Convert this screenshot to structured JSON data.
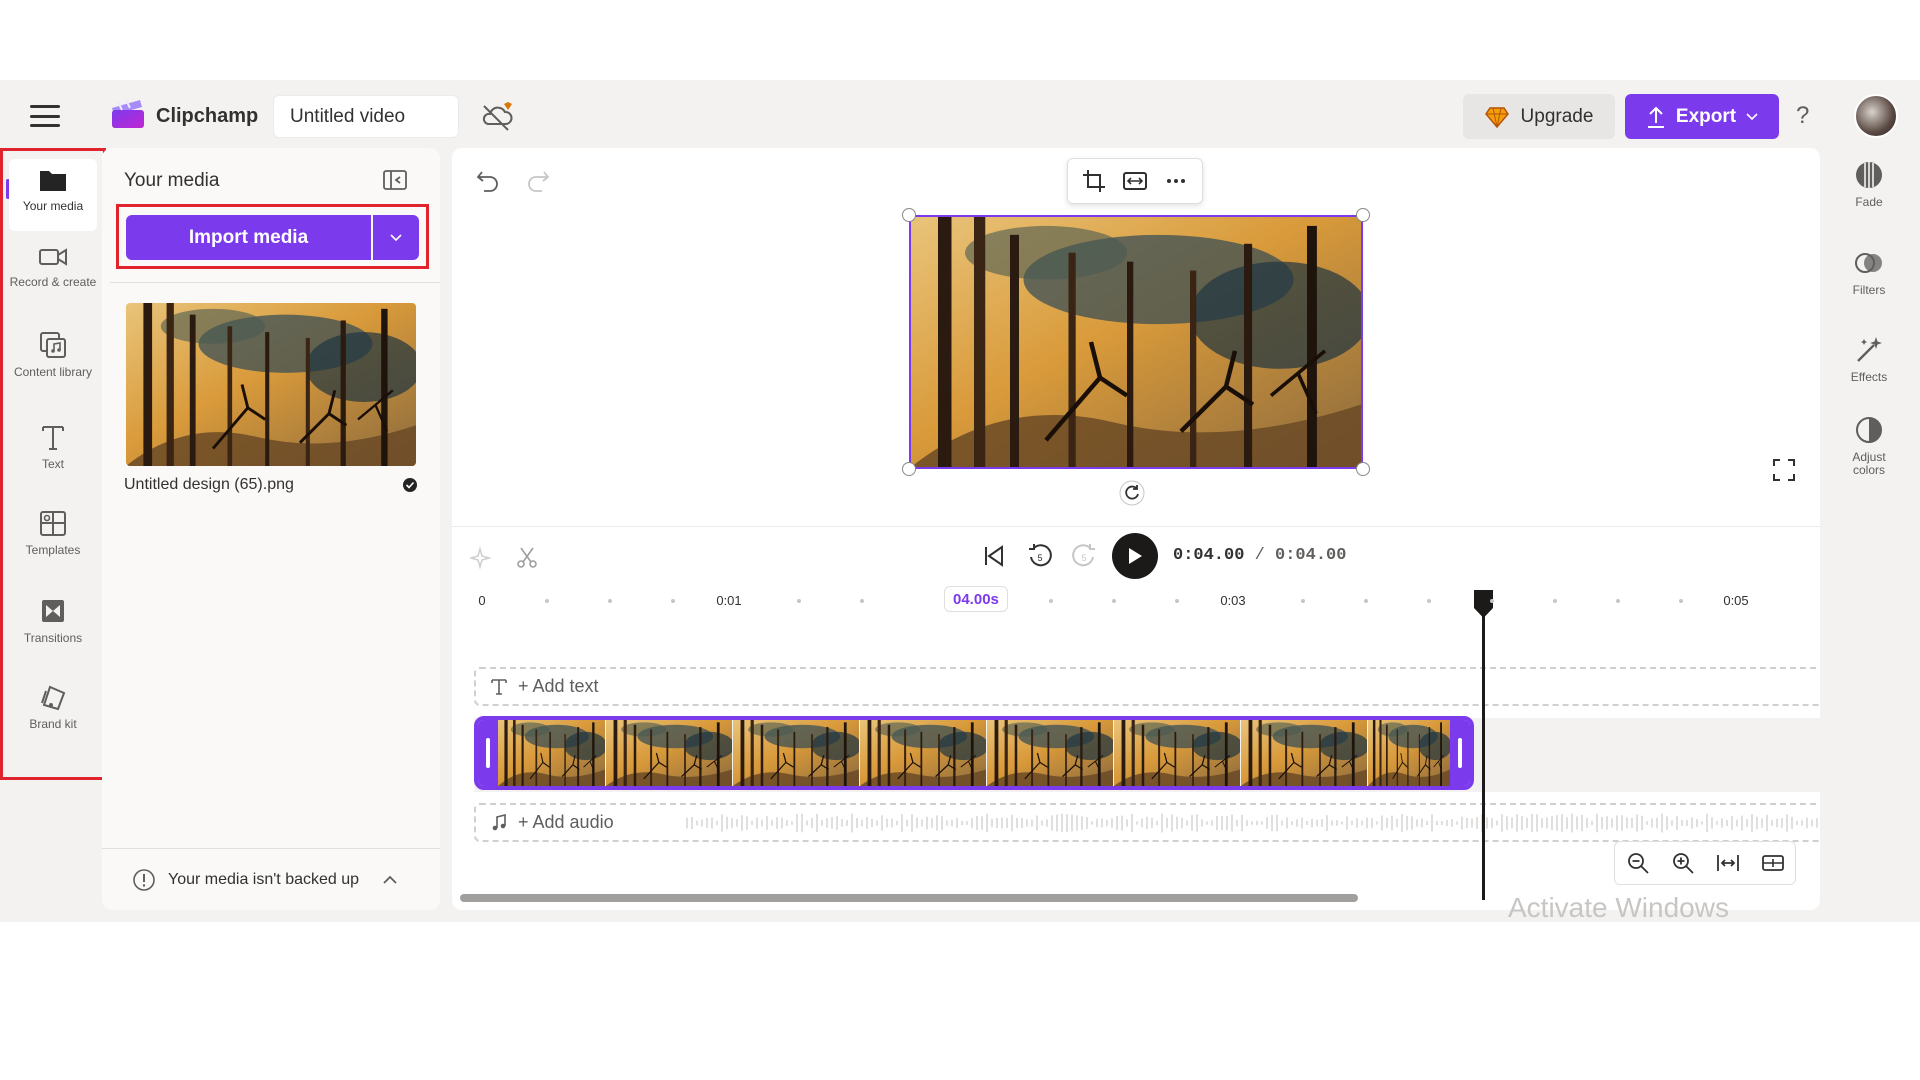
{
  "app": {
    "name": "Clipchamp",
    "project_title": "Untitled video"
  },
  "topbar": {
    "upgrade_label": "Upgrade",
    "export_label": "Export",
    "help_label": "?"
  },
  "left_nav": {
    "items": [
      {
        "label": "Your media",
        "icon": "folder-icon",
        "active": true
      },
      {
        "label": "Record & create",
        "icon": "camera-icon"
      },
      {
        "label": "Content library",
        "icon": "library-icon"
      },
      {
        "label": "Text",
        "icon": "text-icon"
      },
      {
        "label": "Templates",
        "icon": "templates-icon"
      },
      {
        "label": "Transitions",
        "icon": "transitions-icon"
      },
      {
        "label": "Brand kit",
        "icon": "brand-kit-icon"
      }
    ]
  },
  "media_panel": {
    "title": "Your media",
    "import_label": "Import media",
    "file_name": "Untitled design (65).png",
    "backup_text": "Your media isn't backed up"
  },
  "playback": {
    "current_time": "0:04.00",
    "separator": "/",
    "total_time": "0:04.00"
  },
  "timeline": {
    "ticks": [
      "0",
      "0:01",
      "0:03",
      "0:05"
    ],
    "hover_time": "04.00s",
    "add_text": "+ Add text",
    "add_audio": "+ Add audio"
  },
  "right_rail": {
    "items": [
      {
        "label": "Fade",
        "icon": "fade-icon"
      },
      {
        "label": "Filters",
        "icon": "filters-icon"
      },
      {
        "label": "Effects",
        "icon": "effects-icon"
      },
      {
        "label": "Adjust colors",
        "icon": "adjust-colors-icon"
      }
    ]
  },
  "overlay": {
    "watermark": "Activate Windows"
  },
  "colors": {
    "accent": "#7c3aed",
    "highlight_box": "#e0242d",
    "background": "#f3f2f1"
  }
}
